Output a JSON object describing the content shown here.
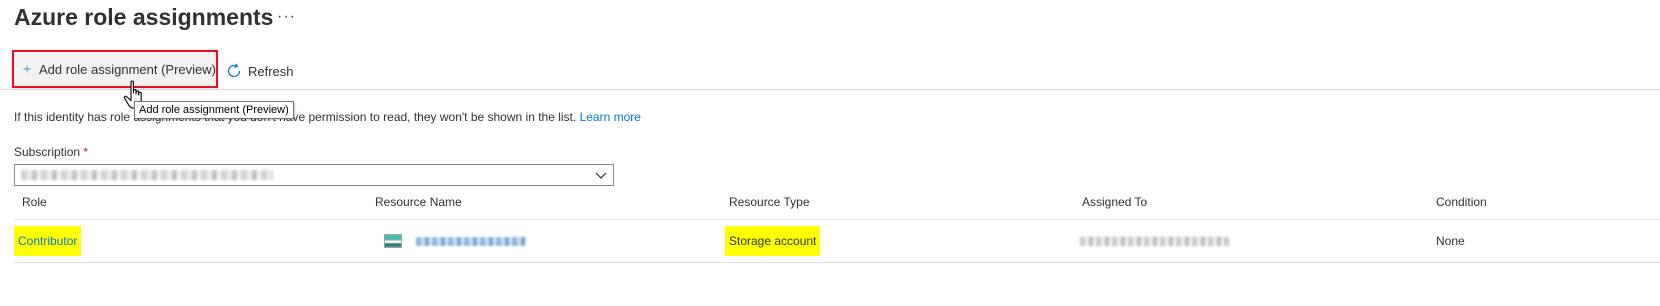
{
  "page": {
    "title": "Azure role assignments",
    "more_label": "···"
  },
  "toolbar": {
    "add_label": "Add role assignment (Preview)",
    "refresh_label": "Refresh",
    "add_icon": "plus-icon",
    "refresh_icon": "refresh-icon",
    "highlight_color": "#e81123"
  },
  "tooltip": {
    "text": "Add role assignment (Preview)"
  },
  "info": {
    "text": "If this identity has role assignments that you don't have permission to read, they won't be shown in the list.",
    "link_text": "Learn more"
  },
  "subscription": {
    "label": "Subscription",
    "required_mark": "*",
    "value": "",
    "value_blurred": true
  },
  "table": {
    "columns": [
      "Role",
      "Resource Name",
      "Resource Type",
      "Assigned To",
      "Condition"
    ],
    "rows": [
      {
        "role": "Contributor",
        "resource_name": "",
        "resource_name_blurred": true,
        "resource_icon": "storage-account-icon",
        "resource_type": "Storage account",
        "assigned_to": "",
        "assigned_to_blurred": true,
        "condition": "None"
      }
    ],
    "highlight_color": "#ffff00"
  }
}
